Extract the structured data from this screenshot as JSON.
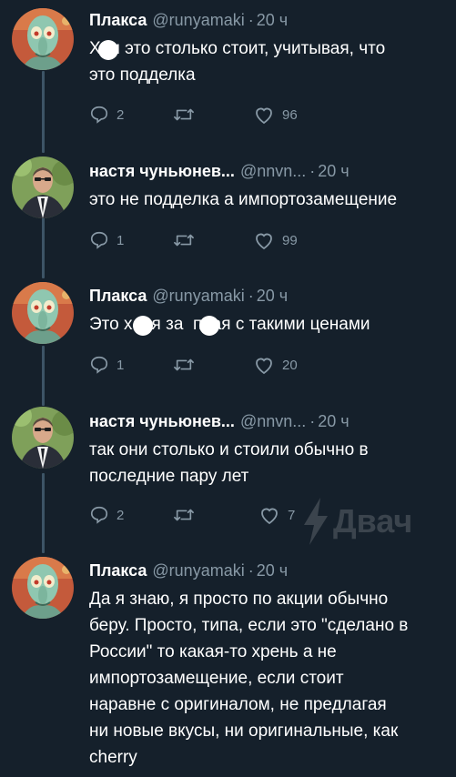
{
  "colors": {
    "background": "#15202b",
    "primary_text": "#ffffff",
    "secondary_text": "#8899a6",
    "thread_line": "#3d5466"
  },
  "watermark": {
    "text": "Двач",
    "icon": "lightning-icon"
  },
  "tweets": [
    {
      "name": "Плакса",
      "handle": "@runyamaki",
      "dot": "·",
      "time": "20 ч",
      "text": "Х  и это столько стоит, учитывая, что\nэто подделка",
      "replies": "2",
      "retweets": "",
      "likes": "96",
      "avatar": "squidward-avatar"
    },
    {
      "name": "настя чуньюнев...",
      "handle": "@nnvn...",
      "dot": "·",
      "time": "20 ч",
      "text": "это не подделка а импортозамещение",
      "replies": "1",
      "retweets": "",
      "likes": "99",
      "avatar": "man-in-suit-avatar"
    },
    {
      "name": "Плакса",
      "handle": "@runyamaki",
      "dot": "·",
      "time": "20 ч",
      "text": "Это х  ня за  пная с такими ценами",
      "replies": "1",
      "retweets": "",
      "likes": "20",
      "avatar": "squidward-avatar"
    },
    {
      "name": "настя чуньюнев...",
      "handle": "@nnvn...",
      "dot": "·",
      "time": "20 ч",
      "text": "так они столько и стоили обычно в\nпоследние пару лет",
      "replies": "2",
      "retweets": "",
      "likes": "7",
      "avatar": "man-in-suit-avatar"
    },
    {
      "name": "Плакса",
      "handle": "@runyamaki",
      "dot": "·",
      "time": "20 ч",
      "text": "Да я знаю, я просто по акции обычно\nберу. Просто, типа, если это \"сделано в\nРоссии\" то какая-то хрень а не\nимпортозамещение, если стоит\nнаравне с оригиналом, не предлагая\nни новые вкусы, ни оригинальные, как\ncherry",
      "avatar": "squidward-avatar"
    }
  ]
}
